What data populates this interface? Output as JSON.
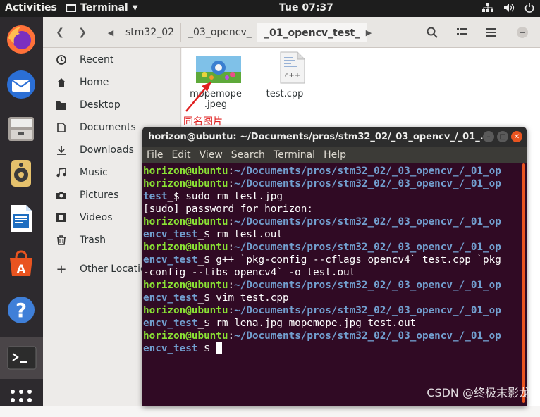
{
  "topbar": {
    "activities": "Activities",
    "app_name": "Terminal",
    "clock": "Tue 07:37"
  },
  "dock": {
    "items": [
      "firefox-icon",
      "thunderbird-icon",
      "files-icon",
      "rhythmbox-icon",
      "writer-icon",
      "software-icon",
      "help-icon",
      "terminal-icon",
      "show-apps-icon"
    ]
  },
  "files": {
    "breadcrumbs": [
      "stm32_02",
      "_03_opencv_",
      "_01_opencv_test_"
    ],
    "sidebar": [
      "Recent",
      "Home",
      "Desktop",
      "Documents",
      "Downloads",
      "Music",
      "Pictures",
      "Videos",
      "Trash",
      "Other Locations"
    ],
    "items": [
      {
        "name_line1": "mopemope",
        "name_line2": ".jpeg"
      },
      {
        "name_line1": "test.cpp",
        "name_line2": ""
      }
    ],
    "annotation": "同名图片"
  },
  "terminal": {
    "title": "horizon@ubuntu: ~/Documents/pros/stm32_02/_03_opencv_/_01_...",
    "menu": [
      "File",
      "Edit",
      "View",
      "Search",
      "Terminal",
      "Help"
    ],
    "lines": [
      {
        "u": "horizon@ubuntu",
        "c": ":",
        "p": "~/Documents/pros/stm32_02/_03_opencv_/_01_op",
        "t": ""
      },
      {
        "u": "horizon@ubuntu",
        "c": ":",
        "p": "~/Documents/pros/stm32_02/_03_opencv_/_01_op",
        "t": ""
      },
      {
        "u": "",
        "c": "",
        "p": "test",
        "t": "_$ sudo rm test.jpg"
      },
      {
        "u": "",
        "c": "",
        "p": "",
        "t": "[sudo] password for horizon:"
      },
      {
        "u": "horizon@ubuntu",
        "c": ":",
        "p": "~/Documents/pros/stm32_02/_03_opencv_/_01_op",
        "t": ""
      },
      {
        "u": "",
        "c": "",
        "p": "encv_test",
        "t": "_$ rm test.out"
      },
      {
        "u": "horizon@ubuntu",
        "c": ":",
        "p": "~/Documents/pros/stm32_02/_03_opencv_/_01_op",
        "t": ""
      },
      {
        "u": "",
        "c": "",
        "p": "encv_test",
        "t": "_$ g++ `pkg-config --cflags opencv4` test.cpp `pkg"
      },
      {
        "u": "",
        "c": "",
        "p": "",
        "t": "-config --libs opencv4` -o test.out"
      },
      {
        "u": "horizon@ubuntu",
        "c": ":",
        "p": "~/Documents/pros/stm32_02/_03_opencv_/_01_op",
        "t": ""
      },
      {
        "u": "",
        "c": "",
        "p": "encv_test",
        "t": "_$ vim test.cpp"
      },
      {
        "u": "horizon@ubuntu",
        "c": ":",
        "p": "~/Documents/pros/stm32_02/_03_opencv_/_01_op",
        "t": ""
      },
      {
        "u": "",
        "c": "",
        "p": "encv_test",
        "t": "_$ rm lena.jpg mopemope.jpg test.out"
      },
      {
        "u": "horizon@ubuntu",
        "c": ":",
        "p": "~/Documents/pros/stm32_02/_03_opencv_/_01_op",
        "t": ""
      },
      {
        "u": "",
        "c": "",
        "p": "encv_test",
        "t": "_$ "
      }
    ]
  },
  "watermark": "CSDN @终极末影龙",
  "colors": {
    "accent": "#e95420",
    "terminal_bg": "#300a24",
    "prompt_user": "#8ae234",
    "prompt_path": "#729fcf",
    "annotation": "#e02020"
  }
}
